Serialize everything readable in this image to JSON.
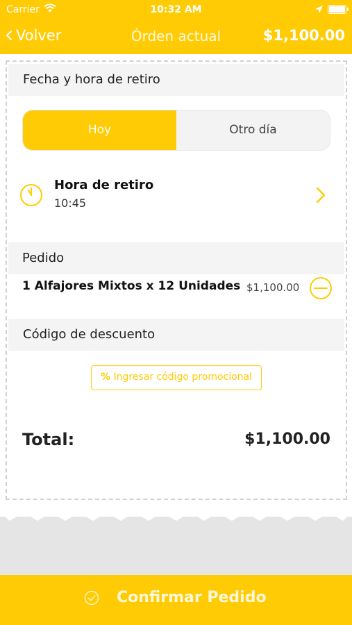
{
  "status_bar": {
    "carrier": "Carrier",
    "time": "10:32 AM"
  },
  "nav": {
    "back_label": "Volver",
    "title": "Órden actual",
    "total": "$1,100.00"
  },
  "pickup": {
    "section_title": "Fecha y hora de retiro",
    "tabs": [
      {
        "label": "Hoy",
        "selected": true
      },
      {
        "label": "Otro día",
        "selected": false
      }
    ],
    "time_label": "Hora de retiro",
    "time_value": "10:45"
  },
  "order": {
    "section_title": "Pedido",
    "items": [
      {
        "name": "1 Alfajores Mixtos x 12 Unidades",
        "price": "$1,100.00"
      }
    ]
  },
  "discount": {
    "section_title": "Código de descuento",
    "promo_icon": "%",
    "promo_label": "Ingresar código promocional"
  },
  "summary": {
    "total_label": "Total:",
    "total_value": "$1,100.00"
  },
  "confirm": {
    "label": "Confirmar Pedido"
  },
  "colors": {
    "accent": "#FFCB05",
    "section_bg": "#f4f4f4",
    "background": "#e5e5e5"
  },
  "icons": {
    "back": "chevron-left-icon",
    "pickup_time": "clock-icon",
    "pickup_open": "chevron-right-icon",
    "remove_item": "minus-circle-icon",
    "confirm": "check-circle-icon",
    "status": [
      "wifi-icon",
      "location-icon",
      "battery-icon"
    ]
  }
}
